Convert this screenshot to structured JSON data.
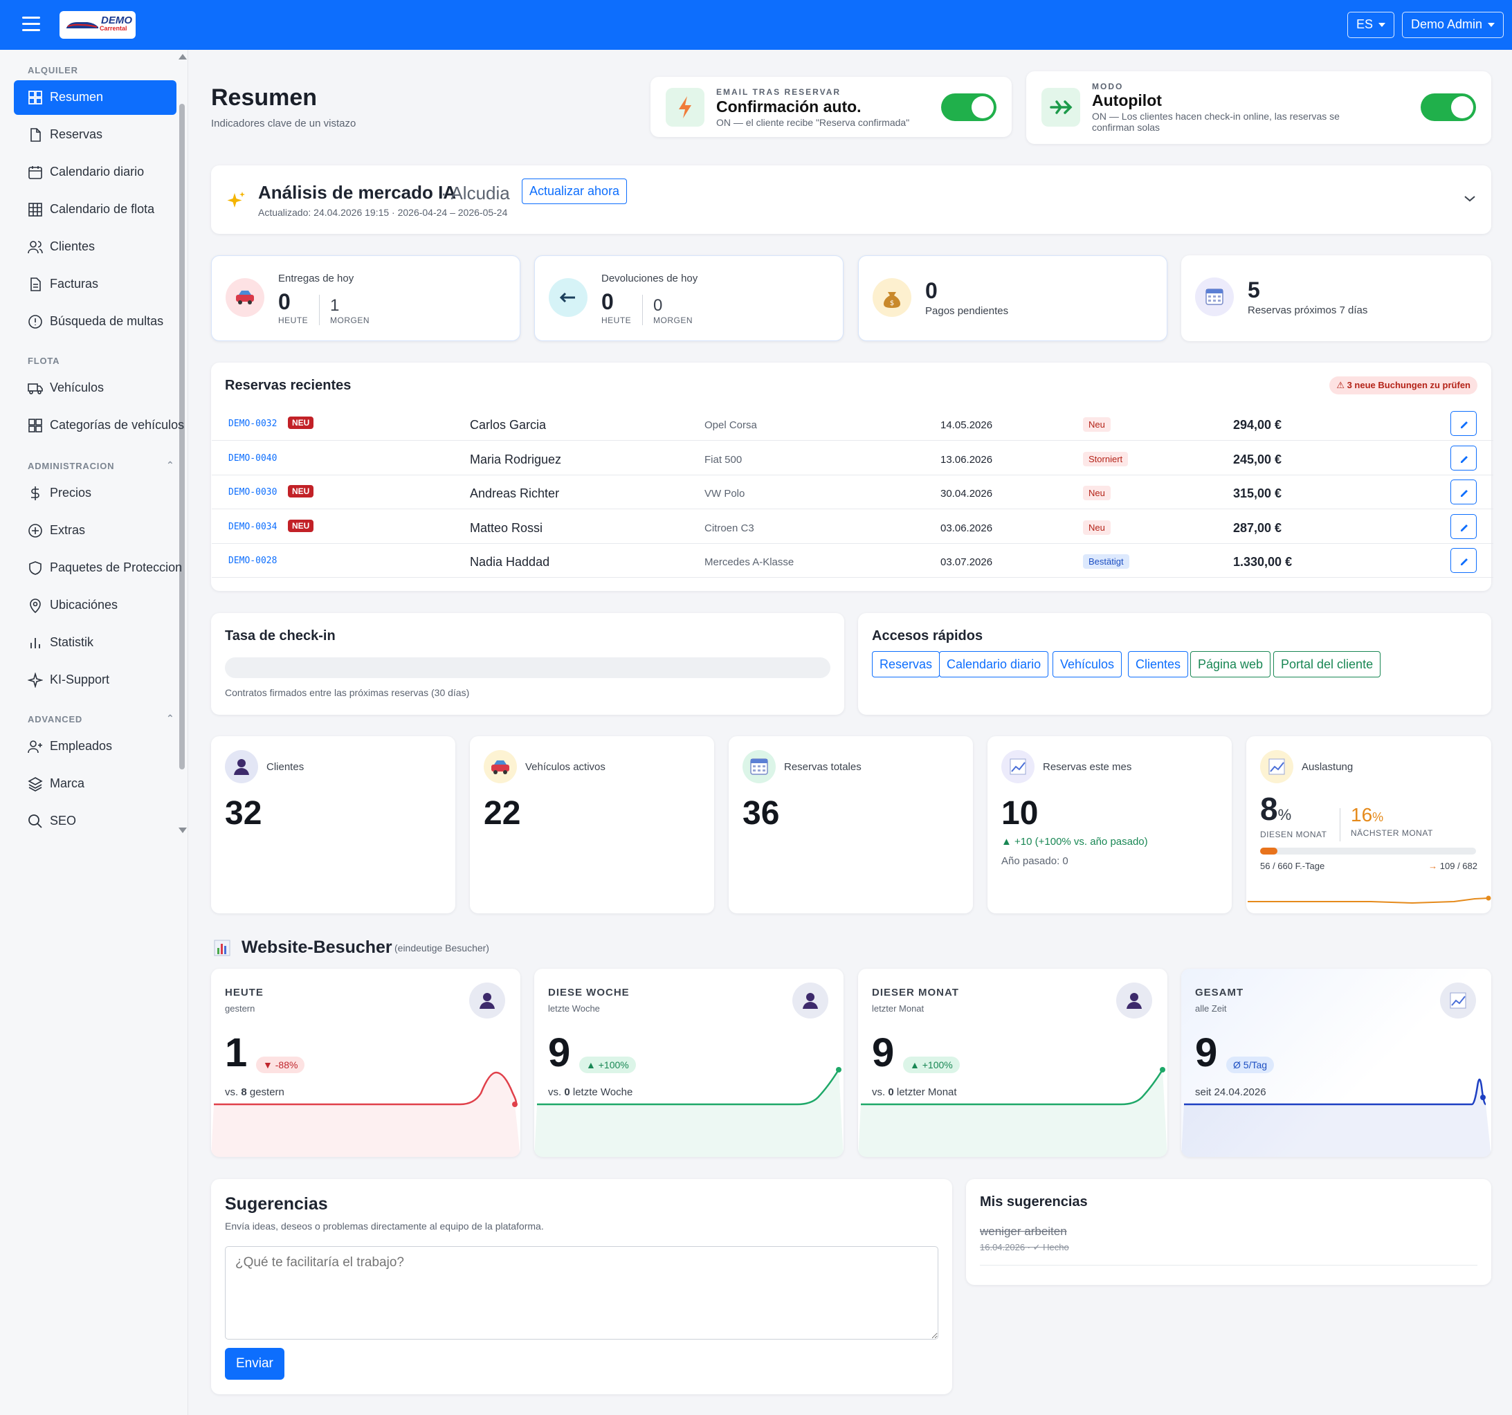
{
  "topbar": {
    "logo_text": "DEMO",
    "logo_sub": "Carrental",
    "lang": "ES",
    "user": "Demo Admin"
  },
  "sidebar": {
    "sections": {
      "alquiler": "ALQUILER",
      "flota": "FLOTA",
      "admin": "ADMINISTRACION",
      "advanced": "ADVANCED"
    },
    "items": [
      {
        "label": "Resumen",
        "icon": "dashboard-icon"
      },
      {
        "label": "Reservas",
        "icon": "file-icon"
      },
      {
        "label": "Calendario diario",
        "icon": "calendar-icon"
      },
      {
        "label": "Calendario de flota",
        "icon": "grid-icon"
      },
      {
        "label": "Clientes",
        "icon": "users-icon"
      },
      {
        "label": "Facturas",
        "icon": "invoice-icon"
      },
      {
        "label": "Búsqueda de multas",
        "icon": "alert-icon"
      },
      {
        "label": "Vehículos",
        "icon": "truck-icon"
      },
      {
        "label": "Categorías de vehículos",
        "icon": "grid-icon"
      },
      {
        "label": "Precios",
        "icon": "dollar-icon"
      },
      {
        "label": "Extras",
        "icon": "plus-circle-icon"
      },
      {
        "label": "Paquetes de Proteccion",
        "icon": "shield-icon"
      },
      {
        "label": "Ubicaciónes",
        "icon": "pin-icon"
      },
      {
        "label": "Statistik",
        "icon": "bar-chart-icon"
      },
      {
        "label": "KI-Support",
        "icon": "sparkle-icon"
      },
      {
        "label": "Empleados",
        "icon": "user-plus-icon"
      },
      {
        "label": "Marca",
        "icon": "layers-icon"
      },
      {
        "label": "SEO",
        "icon": "search-icon"
      }
    ]
  },
  "header": {
    "title": "Resumen",
    "subtitle": "Indicadores clave de un vistazo"
  },
  "toggles": {
    "email": {
      "kicker": "EMAIL TRAS RESERVAR",
      "title": "Confirmación auto.",
      "desc": "ON — el cliente recibe \"Reserva confirmada\"",
      "on": true
    },
    "autopilot": {
      "kicker": "MODO",
      "title": "Autopilot",
      "desc1": "ON — Los clientes hacen check-in online, las reservas se",
      "desc2": "confirman solas",
      "on": true
    }
  },
  "market": {
    "title": "Análisis de mercado IA",
    "location": "· Alcudia",
    "button": "Actualizar ahora",
    "updated": "Actualizado: 24.04.2026 19:15 · 2026-04-24 – 2026-05-24"
  },
  "today": {
    "deliveries": {
      "label": "Entregas de hoy",
      "today": "0",
      "today_lbl": "HEUTE",
      "tomorrow": "1",
      "tomorrow_lbl": "MORGEN"
    },
    "returns": {
      "label": "Devoluciones de hoy",
      "today": "0",
      "today_lbl": "HEUTE",
      "tomorrow": "0",
      "tomorrow_lbl": "MORGEN"
    },
    "payments": {
      "value": "0",
      "label": "Pagos pendientes"
    },
    "next7": {
      "value": "5",
      "label": "Reservas próximos 7 días"
    }
  },
  "recent": {
    "title": "Reservas recientes",
    "alert": "⚠ 3 neue Buchungen zu prüfen",
    "rows": [
      {
        "id": "DEMO-0032",
        "neu": "NEU",
        "name": "Carlos Garcia",
        "car": "Opel Corsa",
        "date": "14.05.2026",
        "status": "Neu",
        "status_color": "#fde8e8",
        "status_text_color": "#b42318",
        "amount": "294,00 €"
      },
      {
        "id": "DEMO-0040",
        "neu": "",
        "name": "Maria Rodriguez",
        "car": "Fiat 500",
        "date": "13.06.2026",
        "status": "Storniert",
        "status_color": "#fde8e8",
        "status_text_color": "#b42318",
        "amount": "245,00 €"
      },
      {
        "id": "DEMO-0030",
        "neu": "NEU",
        "name": "Andreas Richter",
        "car": "VW Polo",
        "date": "30.04.2026",
        "status": "Neu",
        "status_color": "#fde8e8",
        "status_text_color": "#b42318",
        "amount": "315,00 €"
      },
      {
        "id": "DEMO-0034",
        "neu": "NEU",
        "name": "Matteo Rossi",
        "car": "Citroen C3",
        "date": "03.06.2026",
        "status": "Neu",
        "status_color": "#fde8e8",
        "status_text_color": "#b42318",
        "amount": "287,00 €"
      },
      {
        "id": "DEMO-0028",
        "neu": "",
        "name": "Nadia Haddad",
        "car": "Mercedes A-Klasse",
        "date": "03.07.2026",
        "status": "Bestätigt",
        "status_color": "#dde9fd",
        "status_text_color": "#1d4fc2",
        "amount": "1.330,00 €"
      }
    ]
  },
  "checkin": {
    "title": "Tasa de check-in",
    "desc": "Contratos firmados entre las próximas reservas (30 días)",
    "progress": 0
  },
  "quick": {
    "title": "Accesos rápidos",
    "links": [
      {
        "label": "Reservas",
        "color": "#0d6efd"
      },
      {
        "label": "Calendario diario",
        "color": "#0d6efd"
      },
      {
        "label": "Vehículos",
        "color": "#0d6efd"
      },
      {
        "label": "Clientes",
        "color": "#0d6efd"
      },
      {
        "label": "Página web",
        "color": "#198754"
      },
      {
        "label": "Portal del cliente",
        "color": "#198754"
      }
    ]
  },
  "stats": {
    "clients": {
      "label": "Clientes",
      "value": "32"
    },
    "vehicles": {
      "label": "Vehículos activos",
      "value": "22"
    },
    "total": {
      "label": "Reservas totales",
      "value": "36"
    },
    "month": {
      "label": "Reservas este mes",
      "value": "10",
      "delta": "▲ +10 (+100% vs. año pasado)",
      "last": "Año pasado: 0"
    },
    "util": {
      "label": "Auslastung",
      "this": "8",
      "this_lbl": "DIESEN MONAT",
      "next": "16",
      "next_lbl": "NÄCHSTER MONAT",
      "pct": "%",
      "left": "56 / 660 F.-Tage",
      "right": "→ 109 / 682",
      "fill": 0.08
    }
  },
  "visitors": {
    "title": "Website-Besucher",
    "note": "(eindeutige Besucher)",
    "cards": [
      {
        "label": "HEUTE",
        "sub": "gestern",
        "value": "1",
        "badge": "▼ -88%",
        "cmp_pre": "vs. ",
        "cmp_num": "8",
        "cmp_post": " gestern",
        "trend": "down"
      },
      {
        "label": "DIESE WOCHE",
        "sub": "letzte Woche",
        "value": "9",
        "badge": "▲ +100%",
        "cmp_pre": "vs. ",
        "cmp_num": "0",
        "cmp_post": " letzte Woche",
        "trend": "up"
      },
      {
        "label": "DIESER MONAT",
        "sub": "letzter Monat",
        "value": "9",
        "badge": "▲ +100%",
        "cmp_pre": "vs. ",
        "cmp_num": "0",
        "cmp_post": " letzter Monat",
        "trend": "up"
      },
      {
        "label": "GESAMT",
        "sub": "alle Zeit",
        "value": "9",
        "badge": "Ø 5/Tag",
        "cmp_pre": "seit 24.04.2026",
        "cmp_num": "",
        "cmp_post": "",
        "trend": "total"
      }
    ]
  },
  "suggest": {
    "title": "Sugerencias",
    "desc": "Envía ideas, deseos o problemas directamente al equipo de la plataforma.",
    "placeholder": "¿Qué te facilitaría el trabajo?",
    "send": "Enviar"
  },
  "mine": {
    "title": "Mis sugerencias",
    "item": "weniger arbeiten",
    "meta": "16.04.2026 · ✓ Hecho"
  }
}
